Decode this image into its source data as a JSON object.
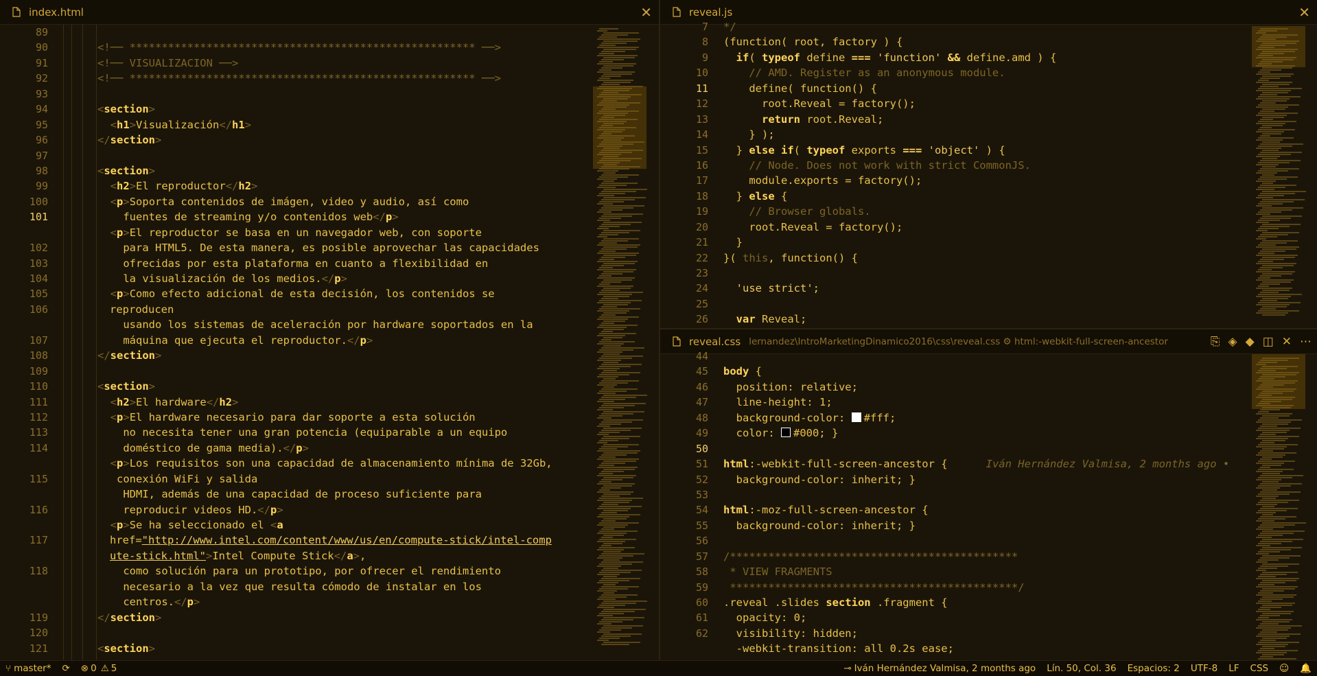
{
  "left_pane": {
    "tab_label": "index.html",
    "file_icon": "file-icon",
    "line_numbers": [
      "89",
      "90",
      "91",
      "92",
      "93",
      "94",
      "95",
      "96",
      "97",
      "98",
      "99",
      "100",
      "101",
      "",
      "102",
      "103",
      "104",
      "105",
      "106",
      "",
      "107",
      "108",
      "109",
      "110",
      "111",
      "112",
      "113",
      "114",
      "",
      "115",
      "",
      "116",
      "",
      "117",
      "",
      "118",
      "",
      "",
      "119",
      "120",
      "121"
    ],
    "current_line": "101"
  },
  "html_code": {
    "c90": "<!── ****************************************************** ──>",
    "c91": "<!── VISUALIZACION ──>",
    "c92": "<!── ****************************************************** ──>",
    "h1_text": "Visualización",
    "h2_reproductor": "El reproductor",
    "p100a": "Soporta contenidos de imágen, video y audio, así como",
    "p100b": "fuentes de streaming y/o contenidos web",
    "p102a": "El reproductor se basa en un navegador web, con soporte",
    "p103": "para HTML5. De esta manera, es posible aprovechar las capacidades",
    "p104": "ofrecidas por esta plataforma en cuanto a flexibilidad en",
    "p105": "la visualización de los medios.",
    "p106a": "Como efecto adicional de esta decisión, los contenidos se",
    "p106b": "reproducen",
    "p107": "usando los sistemas de aceleración por hardware soportados en la",
    "p108": "máquina que ejecuta el reproductor.",
    "h2_hardware": "El hardware",
    "p113": "El hardware necesario para dar soporte a esta solución",
    "p114a": "no necesita tener una gran potencia (equiparable a un equipo",
    "p114b": "doméstico de gama media).",
    "p115a": "Los requisitos son una capacidad de almacenamiento mínima de 32Gb,",
    "p115b": "conexión WiFi y salida",
    "p116a": "HDMI, además de una capacidad de proceso suficiente para",
    "p116b": "reproducir videos HD.",
    "p117a": "Se ha seleccionado el ",
    "href_attr": "href=",
    "url1": "\"http://www.intel.com/content/www/us/en/compute-stick/intel-comp",
    "url2": "ute-stick.html\"",
    "link_text": "Intel Compute Stick",
    "p118a": "como solución para un prototipo, por ofrecer el rendimiento",
    "p118b": "necesario a la vez que resulta cómodo de instalar en los",
    "p118c": "centros."
  },
  "tags": {
    "section": "section",
    "h1": "h1",
    "h2": "h2",
    "p": "p",
    "a": "a"
  },
  "js_pane": {
    "tab_label": "reveal.js",
    "line_numbers": [
      "7",
      "8",
      "9",
      "10",
      "11",
      "12",
      "13",
      "14",
      "15",
      "16",
      "17",
      "18",
      "19",
      "20",
      "21",
      "22",
      "23",
      "24",
      "25",
      "26"
    ],
    "current_line": "11",
    "lines": {
      "l7": "*/",
      "l8": "(function( root, factory ) {",
      "l9a": "if",
      "l9b": "( ",
      "l9c": "typeof",
      "l9d": " define ",
      "l9e": "===",
      "l9f": " 'function' ",
      "l9g": "&&",
      "l9h": " define.amd ) {",
      "l10": "// AMD. Register as an anonymous module.",
      "l11": "define( function() {",
      "l12": "root.Reveal = factory();",
      "l13a": "return",
      "l13b": " root.Reveal;",
      "l14": "} );",
      "l15a": "} ",
      "l15b": "else if",
      "l15c": "( ",
      "l15d": "typeof",
      "l15e": " exports ",
      "l15f": "===",
      "l15g": " 'object' ",
      "l15h": ") {",
      "l16": "// Node. Does not work with strict CommonJS.",
      "l17": "module.exports = factory();",
      "l18a": "} ",
      "l18b": "else",
      "l18c": " {",
      "l19": "// Browser globals.",
      "l20": "root.Reveal = factory();",
      "l21": "}",
      "l22a": "}( ",
      "l22b": "this",
      "l22c": ", function() {",
      "l24": "'use strict';",
      "l26a": "var",
      "l26b": " Reveal;"
    }
  },
  "css_pane": {
    "tab_label": "reveal.css",
    "breadcrumb": "lernandez\\IntroMarketingDinamico2016\\css\\reveal.css",
    "breadcrumb_symbol": "html:-webkit-full-screen-ancestor",
    "line_numbers": [
      "44",
      "45",
      "46",
      "47",
      "48",
      "49",
      "50",
      "51",
      "52",
      "53",
      "54",
      "55",
      "56",
      "57",
      "58",
      "59",
      "60",
      "61",
      "62"
    ],
    "current_line": "50",
    "lines": {
      "l45a": "body",
      "l45b": " {",
      "l46": "position: relative;",
      "l47": "line-height: 1;",
      "l48a": "background-color: ",
      "l48b": "#fff;",
      "l49a": "color: ",
      "l49b": "#000; }",
      "l51a": "html",
      "l51b": ":-webkit-full-screen-ancestor {",
      "l51blame": "Iván Hernández Valmisa, 2 months ago •",
      "l52": "background-color: inherit; }",
      "l54a": "html",
      "l54b": ":-moz-full-screen-ancestor {",
      "l55": "background-color: inherit; }",
      "l57": "/*********************************************",
      "l58": " * VIEW FRAGMENTS",
      "l59": " *********************************************/",
      "l60a": ".reveal .slides ",
      "l60b": "section",
      "l60c": " .fragment {",
      "l61": "opacity: 0;",
      "l62": "visibility: hidden;",
      "l63": "-webkit-transition: all 0.2s ease;"
    },
    "toolbar_icons": [
      "open-changes-icon",
      "previous-change-icon",
      "git-compare-icon",
      "split-editor-icon",
      "close-icon",
      "more-icon"
    ]
  },
  "status_bar": {
    "branch": "master*",
    "errors": "0",
    "warnings": "5",
    "blame": "Iván Hernández Valmisa, 2 months ago",
    "position": "Lín. 50, Col. 36",
    "spaces": "Espacios: 2",
    "encoding": "UTF-8",
    "eol": "LF",
    "language": "CSS"
  },
  "colors": {
    "accent": "#e8c04a",
    "background": "#1b1509",
    "keyword": "#ffd45c",
    "comment": "#7d6526"
  }
}
